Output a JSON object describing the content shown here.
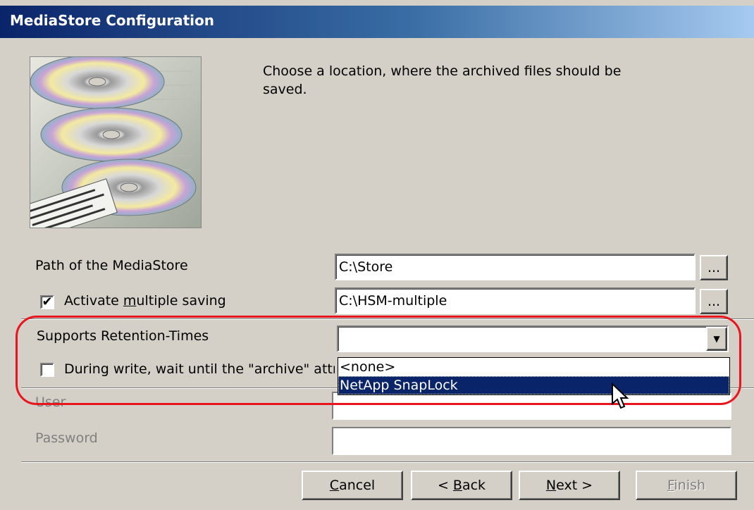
{
  "window": {
    "title": "MediaStore Configuration"
  },
  "intro": {
    "text": "Choose a location, where the archived files should be saved."
  },
  "path": {
    "label": "Path of the MediaStore",
    "value": "C:\\Store",
    "browse_label": "..."
  },
  "multiple": {
    "checked": true,
    "label_pre": "Activate ",
    "label_key": "m",
    "label_post": "ultiple saving",
    "value": "C:\\HSM-multiple",
    "browse_label": "..."
  },
  "retention": {
    "label": "Supports Retention-Times",
    "value": "",
    "options": [
      "<none>",
      "NetApp SnapLock"
    ],
    "highlighted": "NetApp SnapLock"
  },
  "archive_wait": {
    "checked": false,
    "label": "During write, wait until the \"archive\" attr"
  },
  "user": {
    "label": "User",
    "value": ""
  },
  "password": {
    "label": "Password",
    "value": ""
  },
  "buttons": {
    "cancel": {
      "key": "C",
      "rest": "ancel"
    },
    "back": {
      "pre": "< ",
      "key": "B",
      "rest": "ack"
    },
    "next": {
      "key": "N",
      "rest": "ext >"
    },
    "finish": {
      "key": "F",
      "rest": "inish"
    }
  },
  "colors": {
    "highlight": "#0a246a",
    "annotation": "#e8141e",
    "face": "#d4d0c8"
  }
}
